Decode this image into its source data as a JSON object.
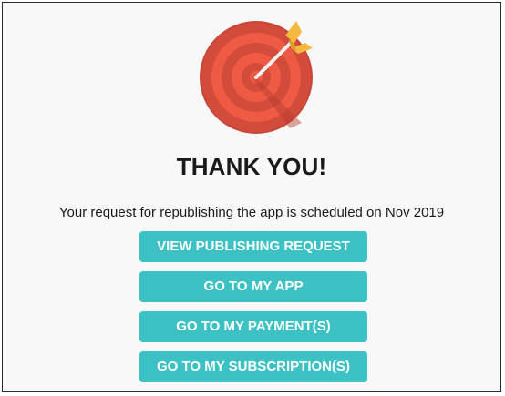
{
  "icon": {
    "name": "target-arrow-icon",
    "colors": {
      "outer": "#d14a3a",
      "inner": "#f0553f",
      "arrow": "#f4b83e",
      "shaft": "#f2f2f2"
    }
  },
  "title": "THANK YOU!",
  "message": "Your request for republishing the app is scheduled on Nov 2019",
  "buttons": {
    "view_publishing_request": "VIEW PUBLISHING REQUEST",
    "go_to_my_app": "GO TO MY APP",
    "go_to_my_payments": "GO TO MY PAYMENT(S)",
    "go_to_my_subscriptions": "GO TO MY SUBSCRIPTION(S)"
  },
  "colors": {
    "accent": "#3cc2c4",
    "background": "#f8f8f8",
    "text": "#1a1a1a"
  }
}
